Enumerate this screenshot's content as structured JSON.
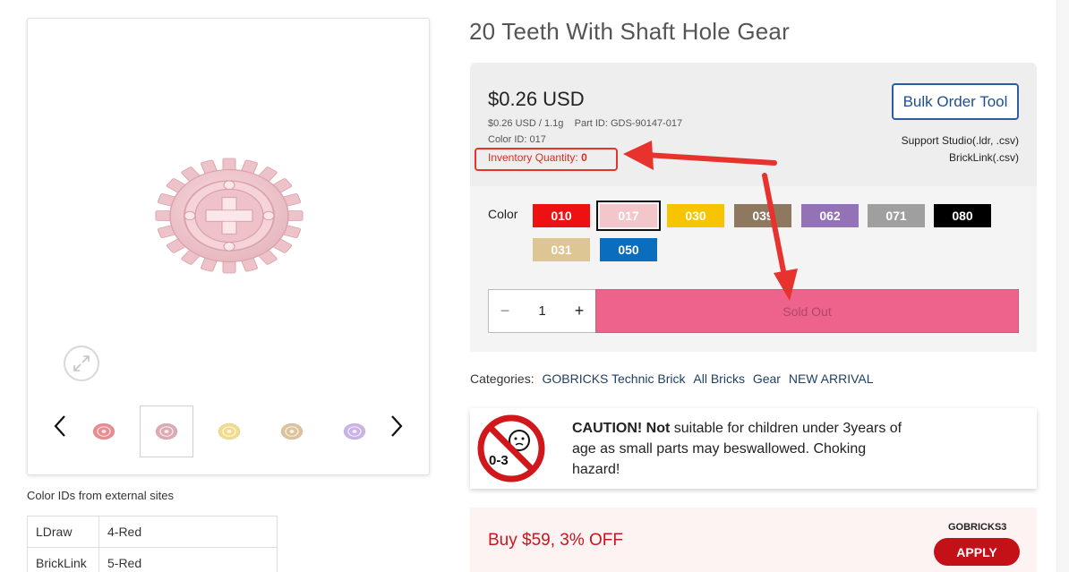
{
  "product": {
    "title": "20 Teeth With Shaft Hole Gear",
    "price": "$0.26 USD",
    "unit_line": "$0.26 USD / 1.1g",
    "part_id_label": "Part ID: GDS-90147-017",
    "color_id_label": "Color ID: 017",
    "inventory_label": "Inventory Quantity:",
    "inventory_value": "0"
  },
  "bulk": {
    "button_label": "Bulk Order Tool",
    "support_line1": "Support Studio(.ldr, .csv)",
    "support_line2": "BrickLink(.csv)"
  },
  "options": {
    "color_label": "Color",
    "swatches": [
      {
        "code": "010",
        "color": "#ee1111"
      },
      {
        "code": "017",
        "color": "#f3c6cc",
        "selected": true
      },
      {
        "code": "030",
        "color": "#f7c400"
      },
      {
        "code": "039",
        "color": "#8e7860"
      },
      {
        "code": "062",
        "color": "#9373b6"
      },
      {
        "code": "071",
        "color": "#9f9f9f"
      },
      {
        "code": "080",
        "color": "#000000"
      },
      {
        "code": "031",
        "color": "#dec594"
      },
      {
        "code": "050",
        "color": "#0b6dbd"
      }
    ]
  },
  "quantity": {
    "minus": "−",
    "value": "1",
    "plus": "+"
  },
  "cart": {
    "sold_out_label": "Sold Out"
  },
  "categories": {
    "label": "Categories:",
    "items": [
      "GOBRICKS Technic Brick",
      "All Bricks",
      "Gear",
      "NEW ARRIVAL"
    ]
  },
  "caution": {
    "bold": "CAUTION! Not",
    "rest": " suitable for children under 3years of age as small parts may beswallowed. Choking hazard!",
    "icon_label": "0-3"
  },
  "promo": {
    "text": "Buy $59, 3% OFF",
    "code": "GOBRICKS3",
    "apply_label": "APPLY"
  },
  "external_ids": {
    "title": "Color IDs from external sites",
    "rows": [
      {
        "site": "LDraw",
        "value": "4-Red"
      },
      {
        "site": "BrickLink",
        "value": "5-Red"
      }
    ]
  },
  "thumbnails": [
    {
      "color": "#e98b8f"
    },
    {
      "color": "#dcaab2",
      "selected": true
    },
    {
      "color": "#f2dc8c"
    },
    {
      "color": "#dcc39c"
    },
    {
      "color": "#c8b2e6"
    }
  ],
  "icons": {
    "zoom": "expand-icon",
    "prev": "chevron-left-icon",
    "next": "chevron-right-icon"
  },
  "colors": {
    "accent_blue": "#2a5ea0",
    "sold_out_pink": "#ee638b",
    "promo_red": "#c41017",
    "annotation_red": "#e8322e"
  }
}
